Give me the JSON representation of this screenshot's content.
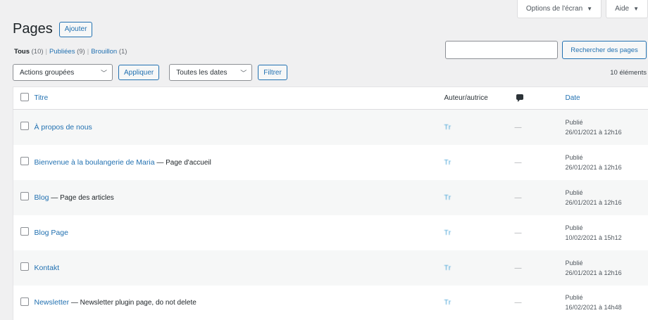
{
  "screen_meta": {
    "options_label": "Options de l'écran",
    "help_label": "Aide"
  },
  "header": {
    "title": "Pages",
    "add_label": "Ajouter"
  },
  "views": {
    "all_label": "Tous",
    "all_count": "(10)",
    "published_label": "Publiées",
    "published_count": "(9)",
    "draft_label": "Brouillon",
    "draft_count": "(1)",
    "separator": "|"
  },
  "search": {
    "value": "",
    "placeholder": "",
    "button_label": "Rechercher des pages"
  },
  "tablenav": {
    "bulk_actions": "Actions groupées",
    "apply_label": "Appliquer",
    "dates_filter": "Toutes les dates",
    "filter_label": "Filtrer",
    "items_count": "10 éléments"
  },
  "columns": {
    "title": "Titre",
    "author": "Auteur/autrice",
    "date": "Date"
  },
  "rows": [
    {
      "title": "À propos de nous",
      "state": "",
      "author": "Tr",
      "comments": "—",
      "status": "Publié",
      "date": "26/01/2021 à 12h16"
    },
    {
      "title": "Bienvenue à la boulangerie de Maria",
      "state": " — Page d'accueil",
      "author": "Tr",
      "comments": "—",
      "status": "Publié",
      "date": "26/01/2021 à 12h16"
    },
    {
      "title": "Blog",
      "state": " — Page des articles",
      "author": "Tr",
      "comments": "—",
      "status": "Publié",
      "date": "26/01/2021 à 12h16"
    },
    {
      "title": "Blog Page",
      "state": "",
      "author": "Tr",
      "comments": "—",
      "status": "Publié",
      "date": "10/02/2021 à 15h12"
    },
    {
      "title": "Kontakt",
      "state": "",
      "author": "Tr",
      "comments": "—",
      "status": "Publié",
      "date": "26/01/2021 à 12h16"
    },
    {
      "title": "Newsletter",
      "state": " — Newsletter plugin page, do not delete",
      "author": "Tr",
      "comments": "—",
      "status": "Publié",
      "date": "16/02/2021 à 14h48"
    }
  ],
  "icons": {
    "comments": "comment-bubble-icon",
    "dropdown": "chevron-down-icon",
    "caret": "caret-down-icon"
  },
  "colors": {
    "link": "#2271b1",
    "background": "#f0f0f1",
    "row_alt": "#f6f7f7"
  }
}
